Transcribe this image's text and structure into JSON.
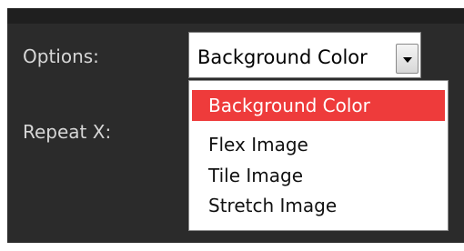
{
  "form": {
    "options_label": "Options:",
    "repeat_x_label": "Repeat X:"
  },
  "select": {
    "current_value": "Background Color",
    "arrow_icon": "chevron-down-icon",
    "options": [
      {
        "label": "Background Color",
        "selected": true
      },
      {
        "label": "Flex Image",
        "selected": false
      },
      {
        "label": "Tile Image",
        "selected": false
      },
      {
        "label": "Stretch Image",
        "selected": false
      }
    ]
  },
  "colors": {
    "panel_bg": "#2b2b2b",
    "label_text": "#d6d6d6",
    "highlight": "#ee3b3b"
  }
}
